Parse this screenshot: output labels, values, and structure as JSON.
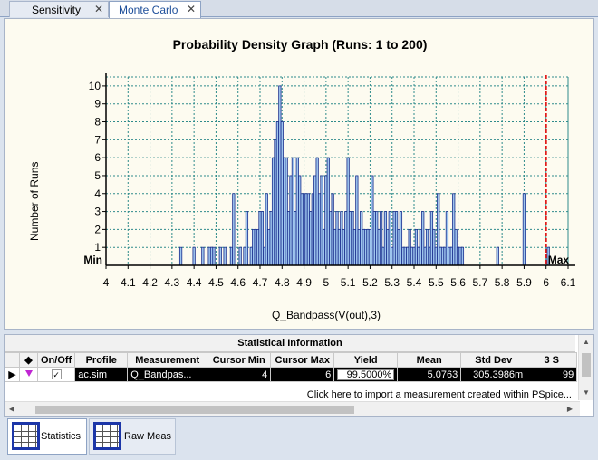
{
  "tabs": [
    {
      "label": "Sensitivity",
      "active": false
    },
    {
      "label": "Monte Carlo",
      "active": true
    }
  ],
  "chart_data": {
    "type": "bar",
    "title": "Probability Density Graph (Runs: 1 to 200)",
    "xlabel": "Q_Bandpass(V(out),3)",
    "ylabel": "Number of Runs",
    "xlim": [
      4,
      6.1
    ],
    "ylim": [
      0,
      10.5
    ],
    "bin_width": 0.01,
    "x_ticks": [
      "4",
      "4.1",
      "4.2",
      "4.3",
      "4.4",
      "4.5",
      "4.6",
      "4.7",
      "4.8",
      "4.9",
      "5",
      "5.1",
      "5.2",
      "5.3",
      "5.4",
      "5.5",
      "5.6",
      "5.7",
      "5.8",
      "5.9",
      "6",
      "6.1"
    ],
    "y_ticks": [
      "1",
      "2",
      "3",
      "4",
      "5",
      "6",
      "7",
      "8",
      "9",
      "10"
    ],
    "grid": true,
    "cursor_min_label": "Min",
    "cursor_max_label": "Max",
    "cursor_min": 4,
    "cursor_max": 6,
    "x": [
      4.34,
      4.4,
      4.44,
      4.47,
      4.48,
      4.49,
      4.52,
      4.54,
      4.57,
      4.58,
      4.61,
      4.63,
      4.64,
      4.66,
      4.67,
      4.68,
      4.69,
      4.7,
      4.71,
      4.72,
      4.73,
      4.74,
      4.75,
      4.76,
      4.77,
      4.78,
      4.79,
      4.8,
      4.81,
      4.82,
      4.83,
      4.84,
      4.85,
      4.86,
      4.87,
      4.88,
      4.89,
      4.9,
      4.91,
      4.92,
      4.93,
      4.94,
      4.95,
      4.96,
      4.97,
      4.98,
      4.99,
      5.0,
      5.01,
      5.02,
      5.03,
      5.04,
      5.05,
      5.06,
      5.07,
      5.08,
      5.09,
      5.1,
      5.11,
      5.12,
      5.13,
      5.14,
      5.15,
      5.16,
      5.17,
      5.18,
      5.19,
      5.2,
      5.21,
      5.22,
      5.23,
      5.24,
      5.25,
      5.26,
      5.27,
      5.28,
      5.29,
      5.3,
      5.31,
      5.32,
      5.33,
      5.34,
      5.35,
      5.36,
      5.37,
      5.38,
      5.39,
      5.4,
      5.41,
      5.42,
      5.43,
      5.44,
      5.45,
      5.46,
      5.47,
      5.48,
      5.49,
      5.5,
      5.51,
      5.52,
      5.53,
      5.54,
      5.55,
      5.56,
      5.57,
      5.58,
      5.59,
      5.6,
      5.61,
      5.62,
      5.78,
      5.9,
      6.01
    ],
    "values": [
      1,
      1,
      1,
      1,
      1,
      1,
      1,
      1,
      1,
      4,
      1,
      1,
      3,
      1,
      2,
      2,
      2,
      3,
      3,
      1,
      4,
      2,
      3,
      6,
      7,
      8,
      10,
      8,
      6,
      6,
      3,
      5,
      6,
      3,
      6,
      5,
      4,
      4,
      4,
      4,
      3,
      4,
      5,
      6,
      4,
      5,
      2,
      5,
      6,
      3,
      4,
      2,
      3,
      2,
      3,
      2,
      3,
      6,
      3,
      3,
      2,
      5,
      2,
      3,
      2,
      2,
      2,
      2,
      5,
      3,
      3,
      2,
      3,
      1,
      3,
      2,
      3,
      1,
      3,
      3,
      2,
      3,
      1,
      1,
      1,
      2,
      1,
      1,
      2,
      1,
      2,
      3,
      1,
      2,
      1,
      3,
      2,
      1,
      4,
      1,
      1,
      1,
      3,
      1,
      1,
      4,
      2,
      1,
      1,
      1,
      1,
      4,
      1,
      1
    ]
  },
  "stats": {
    "title": "Statistical Information",
    "columns": [
      "",
      "◆",
      "On/Off",
      "Profile",
      "Measurement",
      "Cursor Min",
      "Cursor Max",
      "Yield",
      "Mean",
      "Std Dev",
      "3 S"
    ],
    "row": {
      "onoff_check": "✓",
      "profile": "ac.sim",
      "measurement": "Q_Bandpas...",
      "cursor_min": "4",
      "cursor_max": "6",
      "yield": "99.5000%",
      "mean": "5.0763",
      "std_dev": "305.3986m",
      "three_sigma": "99"
    },
    "import_text": "Click here to import a measurement created within PSpice..."
  },
  "bottom_tabs": [
    {
      "label": "Statistics",
      "active": true
    },
    {
      "label": "Raw Meas",
      "active": false
    }
  ],
  "colors": {
    "bar": "#9ec5ee",
    "bar_stroke": "#1a2d8c",
    "grid": "#2e8b8b",
    "cursor": "#e11b1b",
    "plot_bg": "#fdfbf0"
  }
}
